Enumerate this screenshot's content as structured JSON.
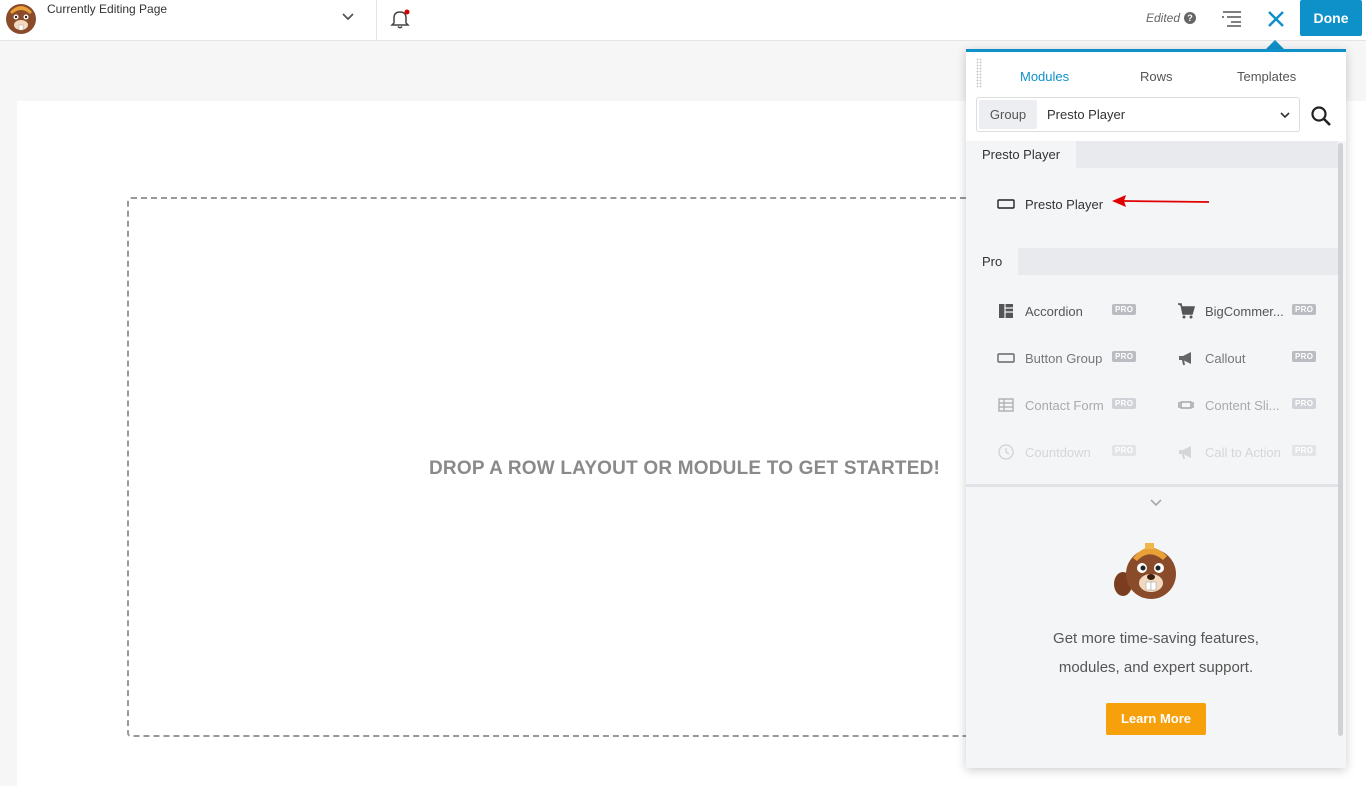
{
  "topbar": {
    "page_title": "Currently Editing Page",
    "edited_label": "Edited",
    "help_glyph": "?",
    "done_label": "Done",
    "icons": [
      "beaver-logo-icon",
      "chevron-down-icon",
      "bell-icon",
      "help-icon",
      "outline-list-icon",
      "close-icon"
    ],
    "accent_color": "#0e91c9"
  },
  "canvas": {
    "drop_text": "DROP A ROW LAYOUT OR MODULE TO GET STARTED!"
  },
  "panel": {
    "tabs": [
      {
        "label": "Modules",
        "active": true
      },
      {
        "label": "Rows",
        "active": false
      },
      {
        "label": "Templates",
        "active": false
      }
    ],
    "group_label": "Group",
    "group_selected": "Presto Player",
    "sections": [
      {
        "title": "Presto Player",
        "modules": [
          {
            "label": "Presto Player",
            "icon": "button-rect-icon",
            "pro": false
          }
        ]
      },
      {
        "title": "Pro",
        "modules": [
          {
            "label": "Accordion",
            "icon": "accordion-icon",
            "pro": true
          },
          {
            "label": "BigCommer...",
            "icon": "cart-icon",
            "pro": true
          },
          {
            "label": "Button Group",
            "icon": "button-rect-icon",
            "pro": true
          },
          {
            "label": "Callout",
            "icon": "megaphone-icon",
            "pro": true
          },
          {
            "label": "Contact Form",
            "icon": "form-table-icon",
            "pro": true
          },
          {
            "label": "Content Sli...",
            "icon": "slider-icon",
            "pro": true
          },
          {
            "label": "Countdown",
            "icon": "clock-icon",
            "pro": true
          },
          {
            "label": "Call to Action",
            "icon": "megaphone-icon",
            "pro": true
          }
        ]
      }
    ],
    "pro_badge": "PRO",
    "promo_line1": "Get more time-saving features,",
    "promo_line2": "modules, and expert support.",
    "learn_more_label": "Learn More",
    "learn_more_color": "#f6a00c"
  }
}
